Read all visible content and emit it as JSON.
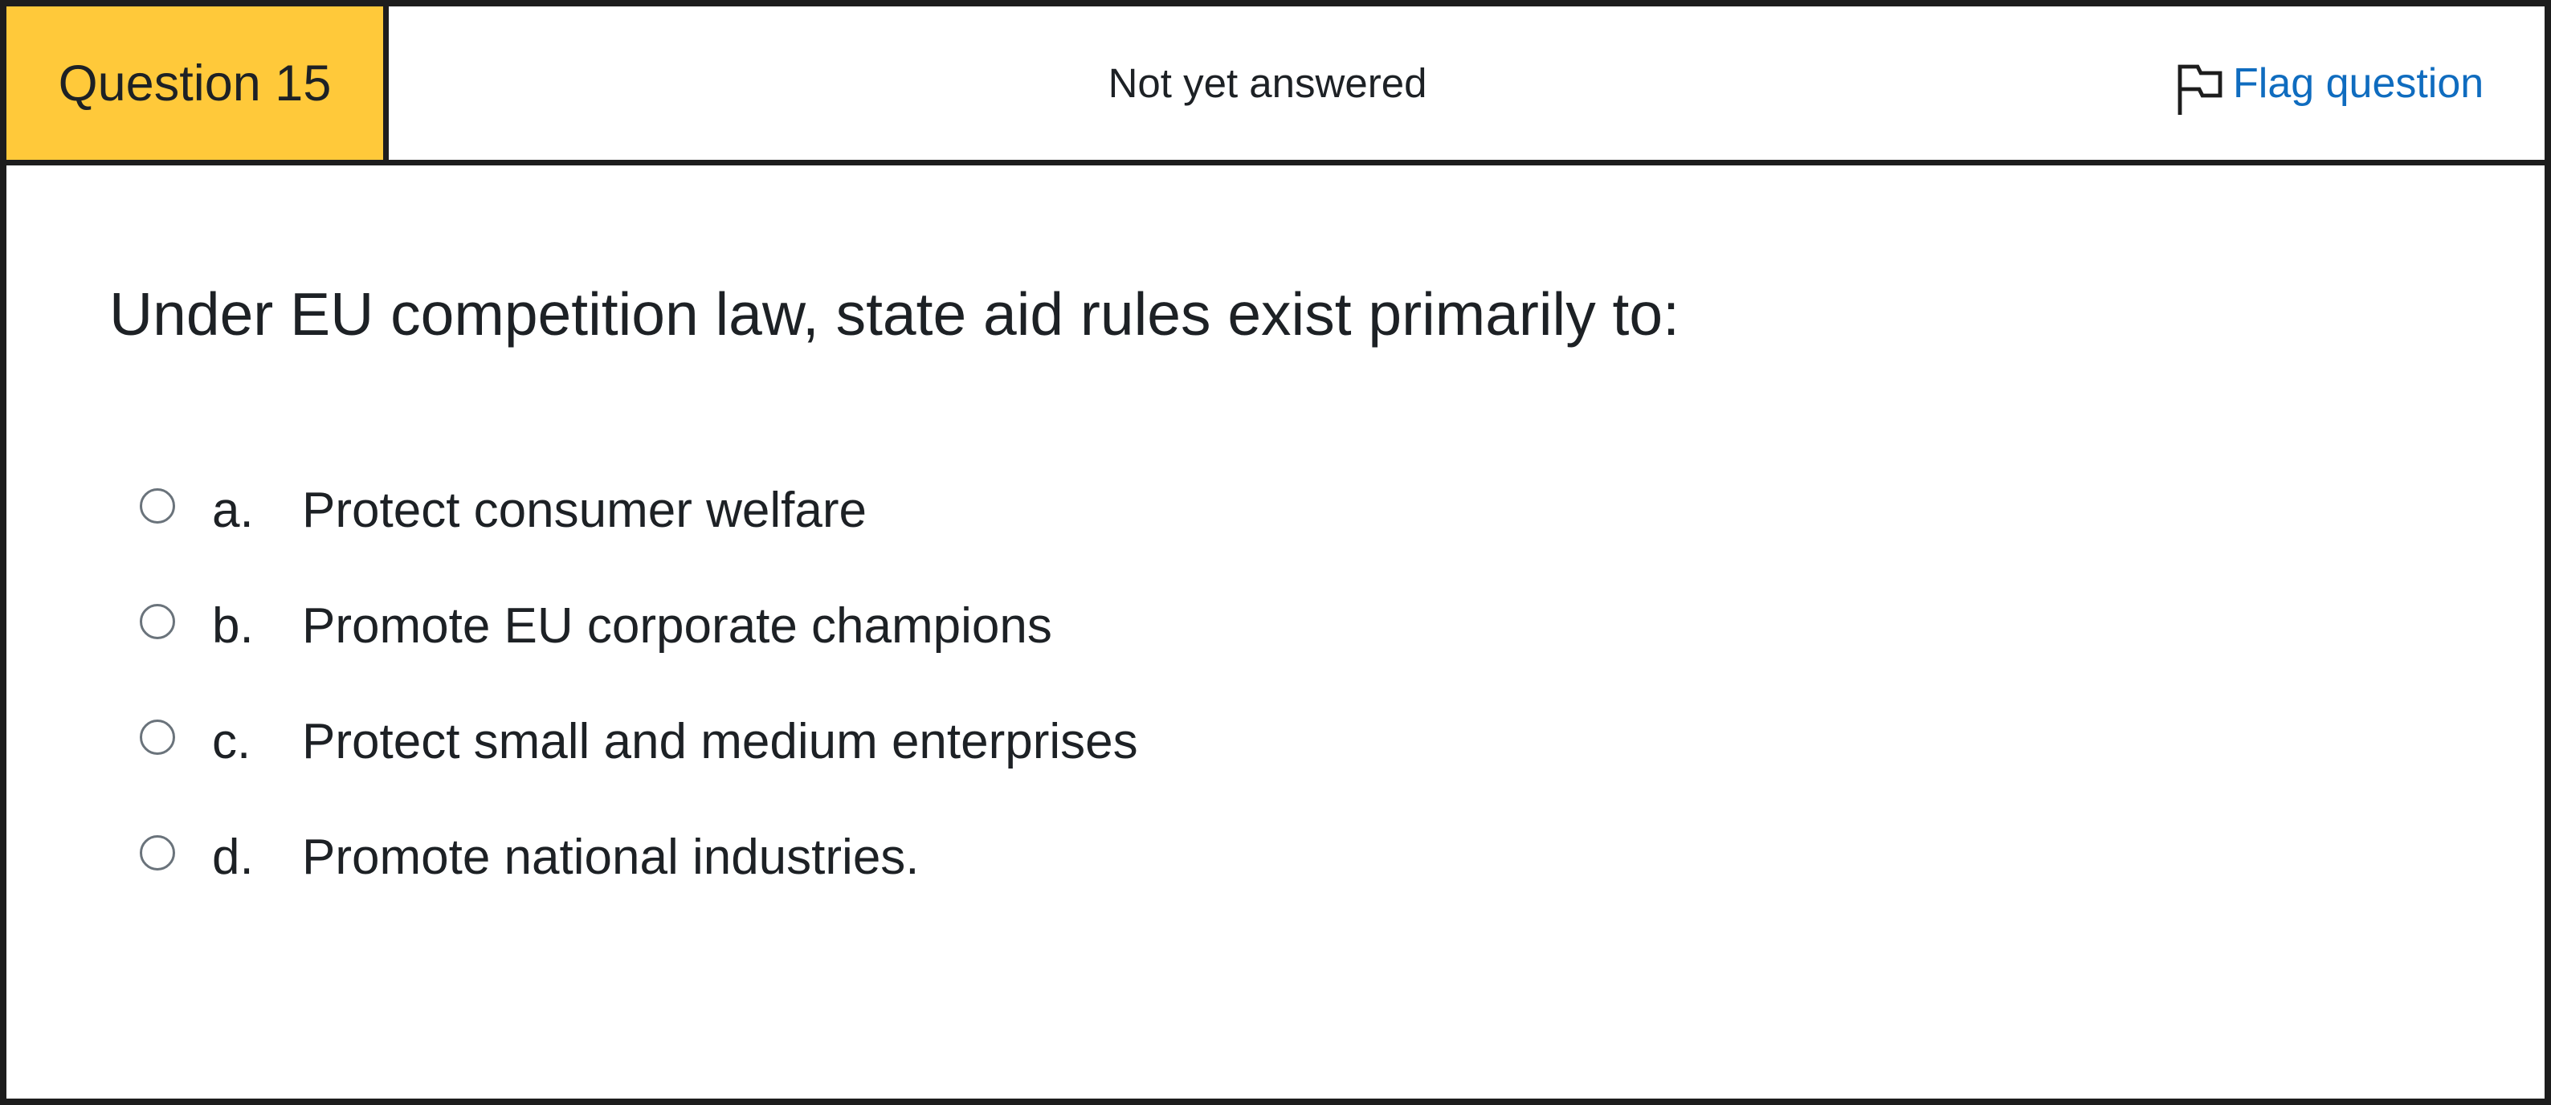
{
  "header": {
    "question_label": "Question 15",
    "status": "Not yet answered",
    "flag_label": "Flag question"
  },
  "question": {
    "text": "Under EU competition law, state aid rules exist primarily to:"
  },
  "answers": [
    {
      "letter": "a.",
      "text": "Protect consumer welfare",
      "selected": false
    },
    {
      "letter": "b.",
      "text": "Promote EU corporate champions",
      "selected": false
    },
    {
      "letter": "c.",
      "text": "Protect small and medium enterprises",
      "selected": false
    },
    {
      "letter": "d.",
      "text": "Promote national industries.",
      "selected": false
    }
  ],
  "colors": {
    "badge_background": "#ffc93a",
    "link": "#0f6cbf",
    "border": "#1d1d1d",
    "text": "#1d2125"
  },
  "icons": {
    "flag": "flag-icon"
  }
}
